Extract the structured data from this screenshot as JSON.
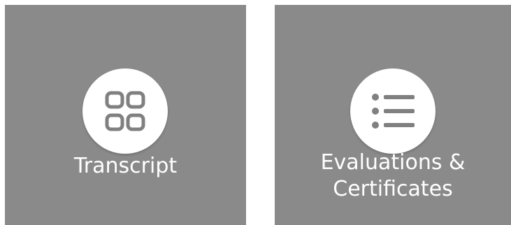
{
  "colors": {
    "tile_background": "#8a8a8a",
    "icon_circle": "#ffffff",
    "icon_glyph": "#808080",
    "label_text": "#ffffff"
  },
  "tiles": [
    {
      "label": "Transcript",
      "icon": "grid-icon"
    },
    {
      "label_line1": "Evaluations &",
      "label_line2": "Certificates",
      "icon": "list-icon"
    }
  ]
}
